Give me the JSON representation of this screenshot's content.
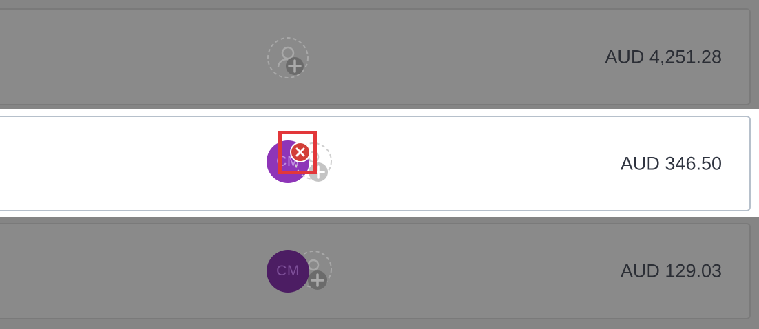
{
  "rows": [
    {
      "amount": "AUD 4,251.28",
      "state": "dimmed",
      "assignee": null
    },
    {
      "amount": "AUD 346.50",
      "state": "active",
      "assignee": {
        "initials": "CM",
        "color": "#8e35b8"
      }
    },
    {
      "amount": "AUD 129.03",
      "state": "dimmed",
      "assignee": {
        "initials": "CM",
        "color": "#4c1d63"
      }
    }
  ],
  "icons": {
    "add_user": "add-user-icon",
    "remove": "remove-assignee-icon"
  },
  "colors": {
    "overlay": "#858585",
    "remove_badge": "#d23f38",
    "highlight": "#e2373a"
  }
}
